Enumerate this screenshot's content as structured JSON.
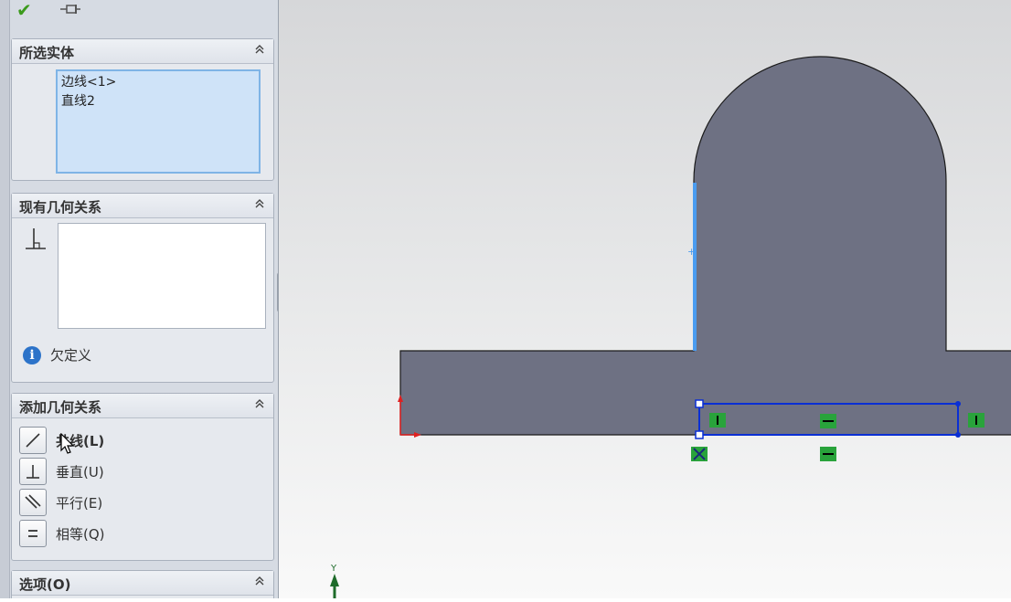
{
  "toolbar": {
    "ok_icon": "check-icon",
    "pin_icon": "pushpin-icon"
  },
  "selected_entities": {
    "title": "所选实体",
    "items": [
      "边线<1>",
      "直线2"
    ]
  },
  "existing_relations": {
    "title": "现有几何关系",
    "relation_icon": "perpendicular-icon",
    "status": "欠定义"
  },
  "add_relations": {
    "title": "添加几何关系",
    "items": [
      {
        "label": "共线(L)",
        "icon": "collinear-icon"
      },
      {
        "label": "垂直(U)",
        "icon": "perpendicular-icon"
      },
      {
        "label": "平行(E)",
        "icon": "parallel-icon"
      },
      {
        "label": "相等(Q)",
        "icon": "equal-icon"
      }
    ]
  },
  "options": {
    "title": "选项(O)"
  },
  "viewport": {
    "axis_label": "Y",
    "colors": {
      "part_fill": "#6e7183",
      "selection": "#0a2fd4",
      "highlight_edge": "#4a9cf0",
      "relation_badge": "#29a33b",
      "origin_red": "#e02020"
    }
  }
}
